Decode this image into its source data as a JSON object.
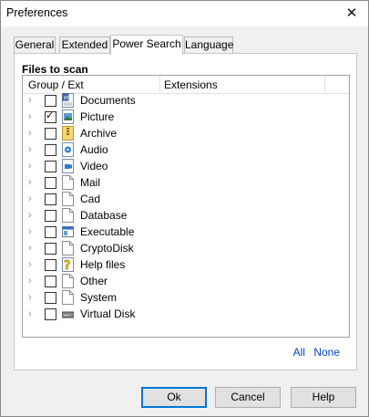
{
  "window": {
    "title": "Preferences",
    "close_glyph": "✕"
  },
  "tabs": [
    {
      "label": "General"
    },
    {
      "label": "Extended"
    },
    {
      "label": "Power Search",
      "active": true
    },
    {
      "label": "Language"
    }
  ],
  "panel": {
    "section_label": "Files to scan",
    "columns": [
      "Group / Ext",
      "Extensions"
    ],
    "rows": [
      {
        "label": "Documents",
        "checked": false,
        "icon": "word-document-icon"
      },
      {
        "label": "Picture",
        "checked": true,
        "icon": "picture-file-icon"
      },
      {
        "label": "Archive",
        "checked": false,
        "icon": "archive-icon"
      },
      {
        "label": "Audio",
        "checked": false,
        "icon": "audio-file-icon"
      },
      {
        "label": "Video",
        "checked": false,
        "icon": "video-file-icon"
      },
      {
        "label": "Mail",
        "checked": false,
        "icon": "blank-file-icon"
      },
      {
        "label": "Cad",
        "checked": false,
        "icon": "blank-file-icon"
      },
      {
        "label": "Database",
        "checked": false,
        "icon": "blank-file-icon"
      },
      {
        "label": "Executable",
        "checked": false,
        "icon": "executable-icon"
      },
      {
        "label": "CryptoDisk",
        "checked": false,
        "icon": "blank-file-icon"
      },
      {
        "label": "Help files",
        "checked": false,
        "icon": "help-file-icon"
      },
      {
        "label": "Other",
        "checked": false,
        "icon": "blank-file-icon"
      },
      {
        "label": "System",
        "checked": false,
        "icon": "blank-file-icon"
      },
      {
        "label": "Virtual Disk",
        "checked": false,
        "icon": "virtual-disk-icon"
      }
    ],
    "select_all": "All",
    "select_none": "None"
  },
  "buttons": {
    "ok": "Ok",
    "cancel": "Cancel",
    "help": "Help"
  },
  "colors": {
    "accent": "#0078d7",
    "link": "#0044cc"
  }
}
